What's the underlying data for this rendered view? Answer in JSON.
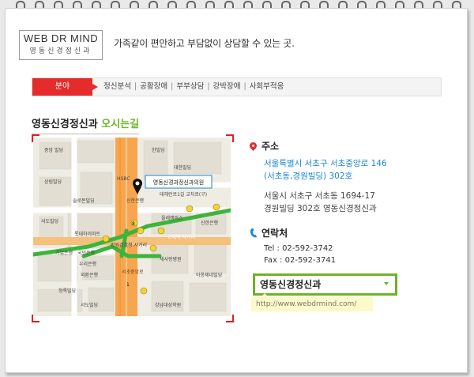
{
  "brand": {
    "logo_line1": "WEB DR MIND",
    "logo_line2": "영동신경정신과",
    "slogan": "가족같이 편안하고 부담없이 상담할 수 있는 곳."
  },
  "category": {
    "tab_label": "분야",
    "items": [
      "정신분석",
      "공황장애",
      "부부상담",
      "강박장애",
      "사회부적응"
    ]
  },
  "section": {
    "title_main": "영동신경정신과",
    "title_hl": "오시는길"
  },
  "map": {
    "marker_label": "영동신경과정신과의원",
    "labels": {
      "bank1": "중앙\n빌딩",
      "bank2": "상림빌딩",
      "bank3": "솔로몬빌딩",
      "bank4": "서도빌딩",
      "bank5": "롯데하이마트",
      "bank6": "기업은행",
      "bank7": "국민은행",
      "bank8": "우리은행",
      "bank9": "외환은행",
      "bank10": "청록빌딩",
      "b1": "한빌딩",
      "b2": "HSBC",
      "b3": "신한은행",
      "b4": "대한빌딩",
      "b5": "올레캠퍼스",
      "b6": "신한은행",
      "b7": "세사랑병원",
      "b8": "아옹제네빌딩",
      "b9": "강남대성학원",
      "b10": "서도빌딩",
      "b11": "테헤란로1길 교차로(구)",
      "road1": "교대역 사거리",
      "road2": "법원검찰청 사거리",
      "road3": "교대역 사거리",
      "road4": "서초중앙로",
      "n1": "1",
      "n2": "8"
    }
  },
  "address": {
    "heading": "주소",
    "line_en1": "서울특별시 서초구 서초중앙로 146",
    "line_en2": "(서초동,경원빌딩) 302호",
    "line_ko1": "서울시 서초구 서초동 1694-17",
    "line_ko2": "경원빌딩 302호 영동신경정신과"
  },
  "contact": {
    "heading": "연락처",
    "tel": "Tel : 02-592-3742",
    "fax": "Fax : 02-592-3741"
  },
  "select": {
    "value": "영동신경정신과"
  },
  "url": "http://www.webdrmind.com/"
}
